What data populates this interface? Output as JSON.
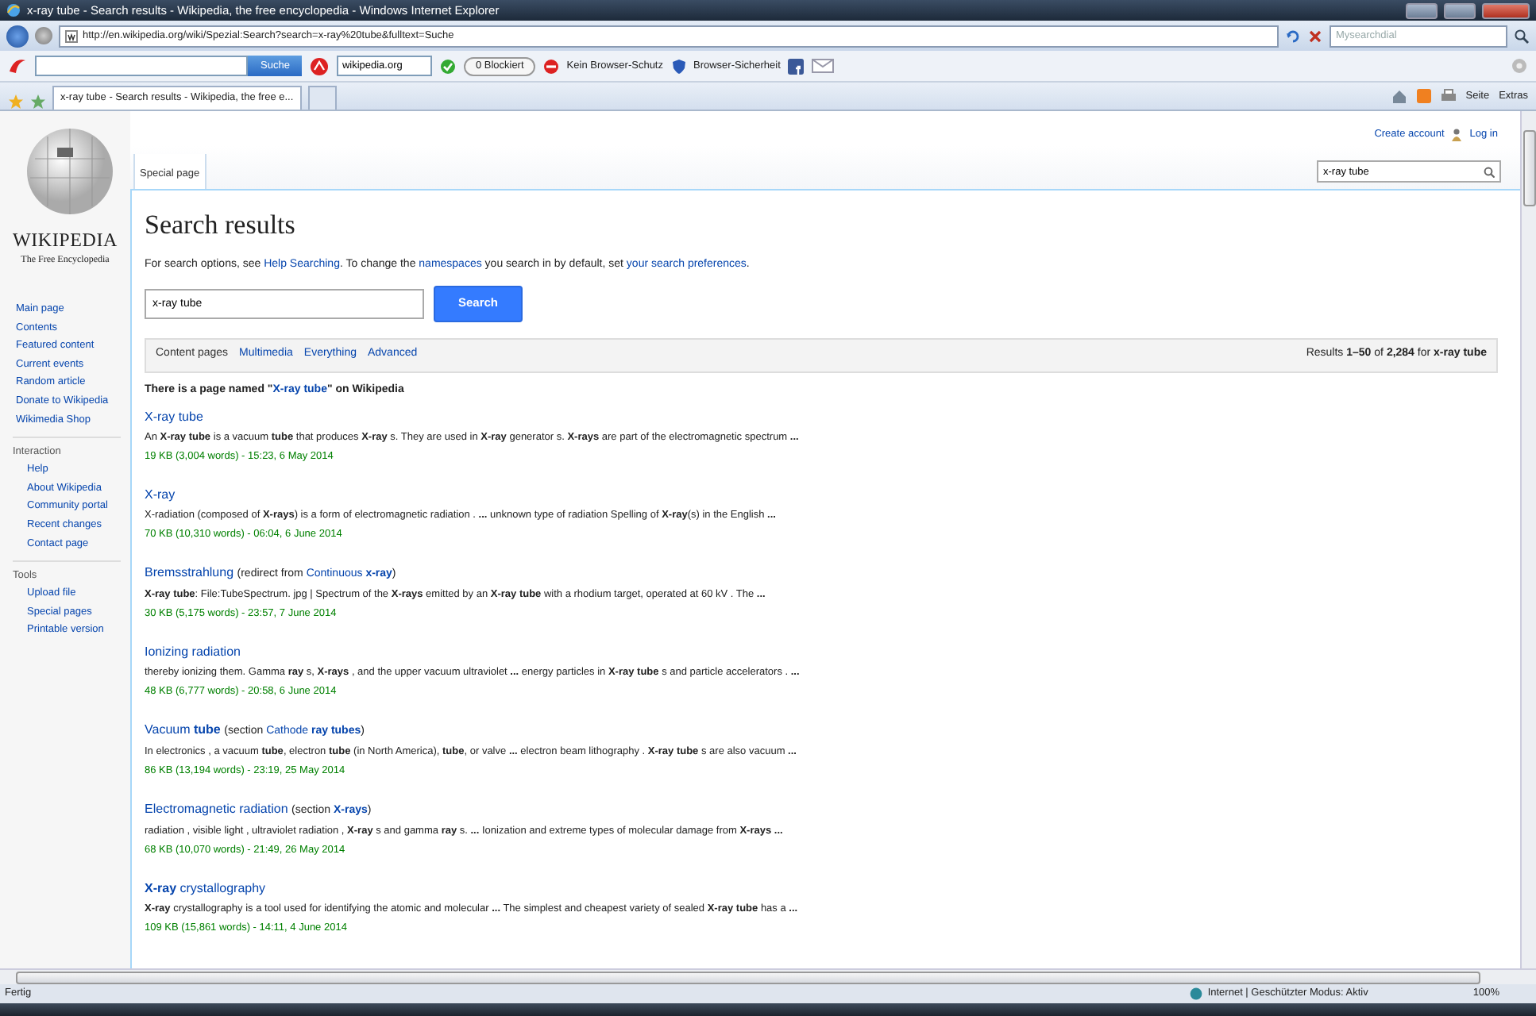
{
  "window": {
    "title": "x-ray tube - Search results - Wikipedia, the free encyclopedia - Windows Internet Explorer"
  },
  "address_bar": {
    "url": "http://en.wikipedia.org/wiki/Spezial:Search?search=x-ray%20tube&fulltext=Suche",
    "search_placeholder": "Mysearchdial"
  },
  "toolbar": {
    "search_button": "Suche",
    "site_field": "wikipedia.org",
    "blocked": "0 Blockiert",
    "protection": "Kein Browser-Schutz",
    "security": "Browser-Sicherheit"
  },
  "browser_tabs": [
    {
      "label": "x-ray tube - Search results - Wikipedia, the free e...",
      "selected": true
    }
  ],
  "command_bar": [
    "Seite",
    "Extras"
  ],
  "page": {
    "personal": [
      "Create account",
      "Log in"
    ],
    "logo": {
      "wordmark": "WIKIPEDIA",
      "tagline": "The Free Encyclopedia"
    },
    "sidebar": [
      {
        "items": [
          "Main page",
          "Contents",
          "Featured content",
          "Current events",
          "Random article",
          "Donate to Wikipedia",
          "Wikimedia Shop"
        ]
      },
      {
        "heading": "Interaction",
        "items": [
          "Help",
          "About Wikipedia",
          "Community portal",
          "Recent changes",
          "Contact page"
        ]
      },
      {
        "heading": "Tools",
        "items": [
          "Upload file",
          "Special pages",
          "Printable version"
        ]
      }
    ],
    "page_tabs": [
      {
        "label": "Special page",
        "selected": true
      }
    ],
    "search_box": {
      "value": "x-ray tube"
    },
    "heading": "Search results",
    "info": [
      {
        "text": "For search options, see "
      },
      {
        "text": "Help Searching",
        "link": true
      },
      {
        "text": ". To change the "
      },
      {
        "text": "namespaces",
        "link": true
      },
      {
        "text": " you search in by default, set "
      },
      {
        "text": "your search preferences",
        "link": true
      },
      {
        "text": "."
      }
    ],
    "query": {
      "value": "x-ray tube",
      "button": "Search"
    },
    "filter_tabs": [
      {
        "label": "Content pages",
        "selected": true
      },
      {
        "label": "Multimedia",
        "selected": false
      },
      {
        "label": "Everything",
        "selected": false
      },
      {
        "label": "Advanced",
        "selected": false
      }
    ],
    "results_summary": "Results **1–50** of **2,284** for **x-ray tube**",
    "exact_match": [
      {
        "text": "There is a page named \""
      },
      {
        "text": "X-ray tube",
        "link": true
      },
      {
        "text": "\" on Wikipedia"
      }
    ],
    "results": [
      {
        "title": "X-ray tube",
        "snippet": "An **X-ray tube** is a vacuum **tube** that produces **X-ray** s. They are used in **X-ray** generator s. **X-rays** are part of the electromagnetic spectrum **...**",
        "meta": "19 KB (3,004 words) - 15:23, 6 May 2014"
      },
      {
        "title": "X-ray",
        "snippet": "X-radiation (composed of **X-rays**) is a form of electromagnetic radiation . **...** unknown type of radiation Spelling of **X-ray**(s) in the English **...**",
        "meta": "70 KB (10,310 words) - 06:04, 6 June 2014"
      },
      {
        "title": "Bremsstrahlung",
        "annotation": [
          {
            "text": "(redirect from "
          },
          {
            "text": "Continuous **x-ray**",
            "link": true
          },
          {
            "text": ")"
          }
        ],
        "snippet": "**X-ray tube**: File:TubeSpectrum. jpg | Spectrum of the **X-rays** emitted by an **X-ray tube** with a rhodium target, operated at 60 kV . The **...**",
        "meta": "30 KB (5,175 words) - 23:57, 7 June 2014"
      },
      {
        "title": "Ionizing radiation",
        "snippet": "thereby ionizing them. Gamma **ray** s, **X-rays** , and the upper vacuum ultraviolet **...** energy particles in **X-ray tube** s and particle accelerators . **...**",
        "meta": "48 KB (6,777 words) - 20:58, 6 June 2014"
      },
      {
        "title": "Vacuum **tube**",
        "annotation": [
          {
            "text": "(section "
          },
          {
            "text": "Cathode **ray tubes**",
            "link": true
          },
          {
            "text": ")"
          }
        ],
        "snippet": "In electronics , a vacuum **tube**, electron **tube** (in North America), **tube**, or valve **...** electron beam lithography . **X-ray tube** s are also vacuum **...**",
        "meta": "86 KB (13,194 words) - 23:19, 25 May 2014"
      },
      {
        "title": "Electromagnetic radiation",
        "annotation": [
          {
            "text": "(section "
          },
          {
            "text": "**X-rays**",
            "link": true
          },
          {
            "text": ")"
          }
        ],
        "snippet": "radiation , visible light , ultraviolet radiation , **X-ray** s and gamma **ray** s. **...** Ionization and extreme types of molecular damage from **X-rays** **...**",
        "meta": "68 KB (10,070 words) - 21:49, 26 May 2014"
      },
      {
        "title": "**X-ray** crystallography",
        "snippet": "**X-ray** crystallography is a tool used for identifying the atomic and molecular **...** The simplest and cheapest variety of sealed **X-ray tube** has a **...**",
        "meta": "109 KB (15,861 words) - 14:11, 4 June 2014"
      }
    ]
  },
  "status_bar": {
    "text": "Fertig",
    "zone": "Internet | Geschützter Modus: Aktiv",
    "zoom": "100%"
  }
}
